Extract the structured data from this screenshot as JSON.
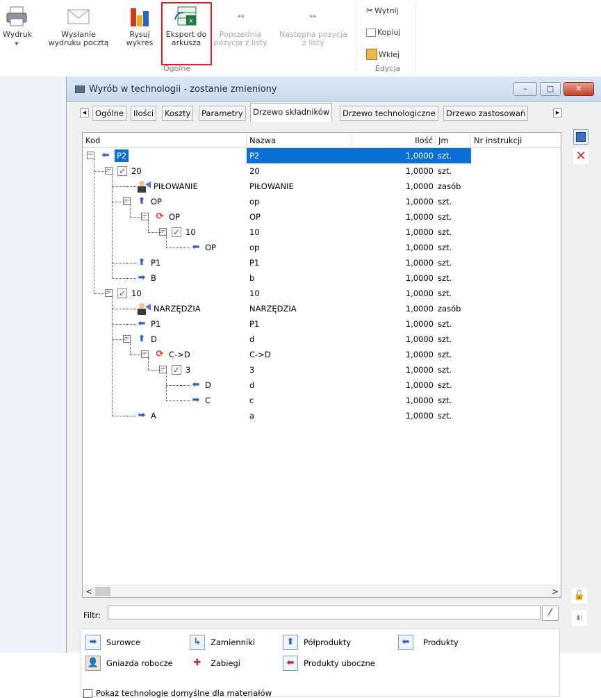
{
  "ribbon": {
    "buttons": [
      {
        "label": "Wydruk",
        "icon": "printer-icon"
      },
      {
        "label": "Wysłanie\nwydruku pocztą",
        "icon": "envelope-icon"
      },
      {
        "label": "Rysuj\nwykres",
        "icon": "bar-chart-icon"
      },
      {
        "label": "Eksport do\narkusza",
        "icon": "excel-export-icon"
      },
      {
        "label": "Poprzednia\npozycja z listy",
        "icon": "previous-icon"
      },
      {
        "label": "Następna pozycja\nz listy",
        "icon": "next-icon"
      }
    ],
    "group_ogolne": "Ogólne",
    "cut": "Wytnij",
    "copy": "Kopiuj",
    "paste": "Wklej",
    "group_edycja": "Edycja"
  },
  "window": {
    "title": "Wyrób w technologii - zostanie zmieniony",
    "btn_min": "–",
    "btn_max": "□",
    "btn_close": "✕"
  },
  "tabs": [
    "Ogólne",
    "Ilości",
    "Koszty",
    "Parametry",
    "Drzewo składników",
    "Drzewo technologiczne",
    "Drzewo zastosowań"
  ],
  "columns": {
    "kod": "Kod",
    "nazwa": "Nazwa",
    "ilosc": "Ilość",
    "jm": "Jm",
    "nr": "Nr instrukcji"
  },
  "rows": [
    {
      "kod": "P2",
      "nazwa": "P2",
      "ilosc": "1,0000",
      "jm": "szt."
    },
    {
      "kod": "20",
      "nazwa": "20",
      "ilosc": "1,0000",
      "jm": "szt."
    },
    {
      "kod": "PIŁOWANIE",
      "nazwa": "PIŁOWANIE",
      "ilosc": "1,0000",
      "jm": "zasób"
    },
    {
      "kod": "OP",
      "nazwa": "op",
      "ilosc": "1,0000",
      "jm": "szt."
    },
    {
      "kod": "OP",
      "nazwa": "OP",
      "ilosc": "1,0000",
      "jm": "szt."
    },
    {
      "kod": "10",
      "nazwa": "10",
      "ilosc": "1,0000",
      "jm": "szt."
    },
    {
      "kod": "OP",
      "nazwa": "op",
      "ilosc": "1,0000",
      "jm": "szt."
    },
    {
      "kod": "P1",
      "nazwa": "P1",
      "ilosc": "1,0000",
      "jm": "szt."
    },
    {
      "kod": "B",
      "nazwa": "b",
      "ilosc": "1,0000",
      "jm": "szt."
    },
    {
      "kod": "10",
      "nazwa": "10",
      "ilosc": "1,0000",
      "jm": "szt."
    },
    {
      "kod": "NARZĘDZIA",
      "nazwa": "NARZĘDZIA",
      "ilosc": "1,0000",
      "jm": "zasób"
    },
    {
      "kod": "P1",
      "nazwa": "P1",
      "ilosc": "1,0000",
      "jm": "szt."
    },
    {
      "kod": "D",
      "nazwa": "d",
      "ilosc": "1,0000",
      "jm": "szt."
    },
    {
      "kod": "C->D",
      "nazwa": "C->D",
      "ilosc": "1,0000",
      "jm": "szt."
    },
    {
      "kod": "3",
      "nazwa": "3",
      "ilosc": "1,0000",
      "jm": "szt."
    },
    {
      "kod": "D",
      "nazwa": "d",
      "ilosc": "1,0000",
      "jm": "szt."
    },
    {
      "kod": "C",
      "nazwa": "c",
      "ilosc": "1,0000",
      "jm": "szt."
    },
    {
      "kod": "A",
      "nazwa": "a",
      "ilosc": "1,0000",
      "jm": "szt."
    }
  ],
  "filter_label": "Filtr:",
  "legend": {
    "surowce": "Surowce",
    "zamienniki": "Zamienniki",
    "polprodukty": "Półprodukty",
    "produkty": "Produkty",
    "gniazda": "Gniazda robocze",
    "zabiegi": "Zabiegi",
    "uboczne": "Produkty uboczne"
  },
  "default_tech": "Pokaż technologie domyślne dla materiałów",
  "colors": {
    "selection": "#0c6fd6",
    "arrow_blue": "#2a63c8",
    "accent_red": "#e02020"
  }
}
